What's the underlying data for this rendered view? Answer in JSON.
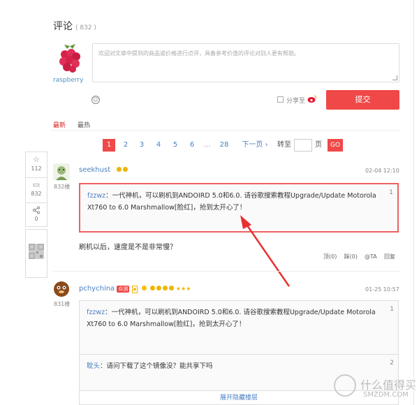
{
  "header": {
    "title": "评论",
    "count": "( 832 )"
  },
  "composer": {
    "username": "raspberry",
    "placeholder": "欢迎对文章中提到的商品或价格进行点评，具备参考价值的评论对别人更有帮助。",
    "share_label": "分享至",
    "submit_label": "提交"
  },
  "sort": {
    "newest": "最新",
    "hottest": "最热"
  },
  "pagination": {
    "pages": [
      "1",
      "2",
      "3",
      "4",
      "5",
      "6",
      "...",
      "28"
    ],
    "next": "下一页 ›",
    "goto_prefix": "转至",
    "goto_suffix": "页",
    "go": "GO"
  },
  "sidebar": {
    "likes": "112",
    "comments": "832",
    "share": "0"
  },
  "comments": [
    {
      "floor": "832楼",
      "user": "seekhust",
      "date": "02-04 12:10",
      "quote_num": "1",
      "quote_user": "fzzwz",
      "quote_text": "：一代神机，可以刷机到ANDOIRD 5.0和6.0. 请谷歌搜索教程Upgrade/Update Motorola Xt760 to 6.0 Marshmallow[脸红]，抢到太开心了！",
      "reply": "刷机以后，速度是不是非常慢？",
      "actions": [
        "顶(0)",
        "踩(0)",
        "@TA",
        "回复"
      ]
    },
    {
      "floor": "831楼",
      "user": "pchychina",
      "badge": "众测",
      "date": "01-25 10:57",
      "quote_num": "1",
      "quote_user": "fzzwz",
      "quote_text": "：一代神机，可以刷机到ANDOIRD 5.0和6.0. 请谷歌搜索教程Upgrade/Update Motorola Xt760 to 6.0 Marshmallow[脸红]，抢到太开心了！",
      "quote2_num": "2",
      "quote2_user": "耽头",
      "quote2_text": "：请问下载了这个镜像没？能共享下吗",
      "expand": "展开隐藏楼层"
    }
  ],
  "watermark": {
    "title": "什么值得买",
    "sub": "SMZDM.COM"
  },
  "colors": {
    "accent": "#f04848",
    "link": "#4a7fc1",
    "highlight": "#f06060"
  }
}
